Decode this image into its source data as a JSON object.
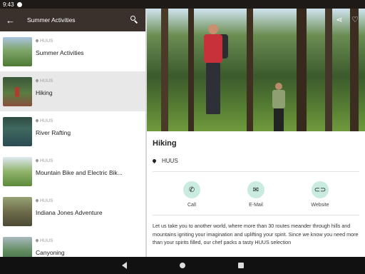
{
  "status_bar": {
    "time": "9:43"
  },
  "list_pane": {
    "back_glyph": "←",
    "title": "Summer Activities",
    "items": [
      {
        "location": "HUUS",
        "name": "Summer Activities"
      },
      {
        "location": "HUUS",
        "name": "Hiking"
      },
      {
        "location": "HUUS",
        "name": "River Rafting"
      },
      {
        "location": "HUUS",
        "name": "Mountain Bike and Electric Bik..."
      },
      {
        "location": "HUUS",
        "name": "Indiana Jones Adventure"
      },
      {
        "location": "HUUS",
        "name": "Canyoning"
      }
    ]
  },
  "detail": {
    "title": "Hiking",
    "location": "HUUS",
    "actions": {
      "call": "Call",
      "email": "E-Mail",
      "website": "Website"
    },
    "description": "Let us take you to another world, where more than 30 routes meander through hills and mountains igniting your imagination and uplifting your spirit. Since we know you need more than your spirits filled, our chef packs a tasty HUUS selection"
  },
  "icons": {
    "call": "phone-icon",
    "email": "mail-icon",
    "website": "link-icon",
    "share": "share-icon",
    "favorite": "heart-icon"
  },
  "colors": {
    "app_bar": "#3a302c",
    "action_circle": "#c9ebe0",
    "selected_row": "#e8e8e8"
  }
}
